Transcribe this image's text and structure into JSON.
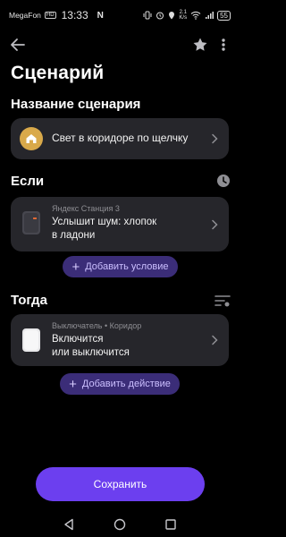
{
  "status": {
    "carrier": "MegaFon",
    "network_badge": "HD",
    "time": "13:33",
    "nfc": "N",
    "speed_top": "2.1",
    "speed_bottom": "K/s",
    "battery": "55"
  },
  "header": {
    "title": "Сценарий"
  },
  "name_section": {
    "heading": "Название сценария",
    "scenario_name": "Свет в коридоре по щелчку",
    "icon": "home-icon"
  },
  "if_section": {
    "heading": "Если",
    "device_name": "Яндекс Станция 3",
    "condition_line1": "Услышит шум: хлопок",
    "condition_line2": "в ладони",
    "add_label": "Добавить условие"
  },
  "then_section": {
    "heading": "Тогда",
    "device_name": "Выключатель",
    "room": "Коридор",
    "separator": "•",
    "action_line1": "Включится",
    "action_line2": "или выключится",
    "add_label": "Добавить действие"
  },
  "save_label": "Сохранить",
  "colors": {
    "background": "#000000",
    "card": "#26262b",
    "accent": "#6c3fef",
    "pill": "#3b2d78",
    "home_badge": "#d9a94a"
  }
}
